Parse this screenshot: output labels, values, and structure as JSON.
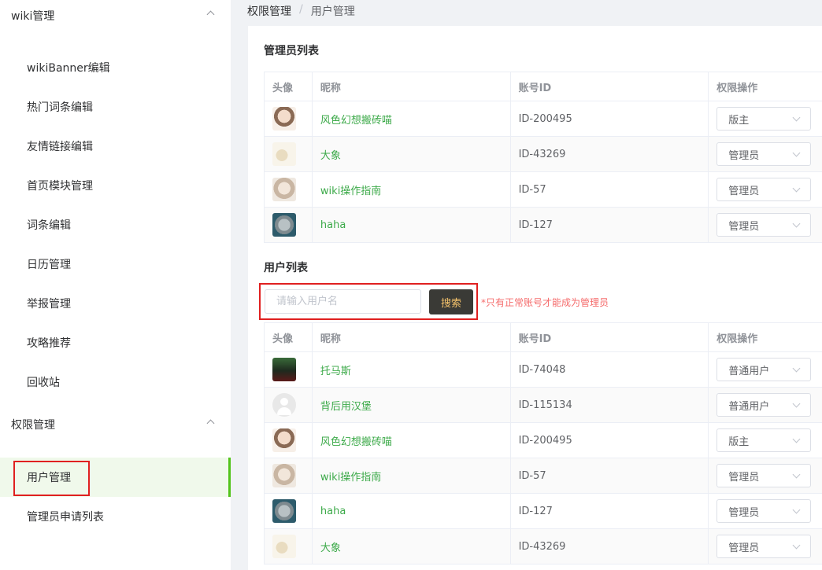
{
  "sidebar": {
    "groups": [
      {
        "title": "wiki管理"
      },
      {
        "title": "权限管理"
      }
    ],
    "wiki_items": [
      "wikiBanner编辑",
      "热门词条编辑",
      "友情链接编辑",
      "首页模块管理",
      "词条编辑",
      "日历管理",
      "举报管理",
      "攻略推荐",
      "回收站"
    ],
    "perm_items": [
      "用户管理",
      "管理员申请列表"
    ],
    "active_item": "用户管理",
    "accent_color": "#52c41a"
  },
  "breadcrumb": {
    "root": "权限管理",
    "separator": "/",
    "current": "用户管理"
  },
  "admin_section": {
    "title": "管理员列表",
    "columns": [
      "头像",
      "昵称",
      "账号ID",
      "权限操作"
    ],
    "rows": [
      {
        "avatar": "anime-girl-avatar",
        "nickname": "风色幻想搬砖喵",
        "account_id": "ID-200495",
        "role": "版主"
      },
      {
        "avatar": "moon-avatar",
        "nickname": "大象",
        "account_id": "ID-43269",
        "role": "管理员"
      },
      {
        "avatar": "anime-girl2-avatar",
        "nickname": "wiki操作指南",
        "account_id": "ID-57",
        "role": "管理员"
      },
      {
        "avatar": "coin-avatar",
        "nickname": "haha",
        "account_id": "ID-127",
        "role": "管理员"
      }
    ]
  },
  "user_section": {
    "title": "用户列表",
    "search_placeholder": "请输入用户名",
    "search_button": "搜索",
    "hint": "*只有正常账号才能成为管理员",
    "columns": [
      "头像",
      "昵称",
      "账号ID",
      "权限操作"
    ],
    "rows": [
      {
        "avatar": "train-avatar",
        "nickname": "托马斯",
        "account_id": "ID-74048",
        "role": "普通用户"
      },
      {
        "avatar": "default-avatar",
        "nickname": "背后用汉堡",
        "account_id": "ID-115134",
        "role": "普通用户"
      },
      {
        "avatar": "anime-girl-avatar",
        "nickname": "风色幻想搬砖喵",
        "account_id": "ID-200495",
        "role": "版主"
      },
      {
        "avatar": "anime-girl2-avatar",
        "nickname": "wiki操作指南",
        "account_id": "ID-57",
        "role": "管理员"
      },
      {
        "avatar": "coin-avatar",
        "nickname": "haha",
        "account_id": "ID-127",
        "role": "管理员"
      },
      {
        "avatar": "moon-avatar",
        "nickname": "大象",
        "account_id": "ID-43269",
        "role": "管理员"
      }
    ]
  }
}
